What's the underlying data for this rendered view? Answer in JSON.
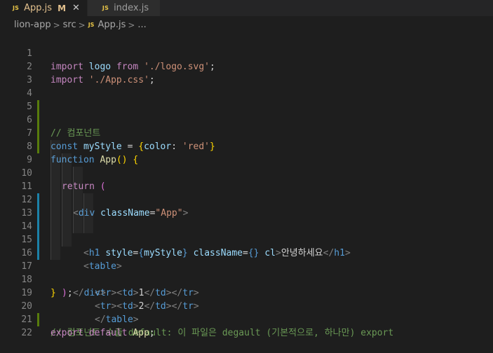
{
  "tabs": [
    {
      "label": "App.js",
      "badge": "JS",
      "modified": "M",
      "active": true
    },
    {
      "label": "index.js",
      "badge": "JS",
      "active": false
    }
  ],
  "breadcrumb": {
    "items": [
      "lion-app",
      "src",
      "App.js",
      "..."
    ],
    "file_badge": "JS"
  },
  "line_numbers": [
    "1",
    "2",
    "3",
    "4",
    "5",
    "6",
    "7",
    "8",
    "9",
    "10",
    "11",
    "12",
    "13",
    "14",
    "15",
    "16",
    "17",
    "18",
    "19",
    "20",
    "21",
    "22"
  ],
  "code": {
    "l1": {
      "kw": "import",
      "id": "logo",
      "from": "from",
      "str": "'./logo.svg'",
      "end": ";"
    },
    "l2": {
      "kw": "import",
      "str": "'./App.css'",
      "end": ";"
    },
    "l5": {
      "comment": "// 컴포넌트"
    },
    "l6": {
      "kw": "const",
      "id": "myStyle",
      "eq": "=",
      "ob": "{",
      "prop": "color",
      "colon": ":",
      "str": "'red'",
      "cb": "}"
    },
    "l8": {
      "kw": "function",
      "name": "App",
      "paren": "()",
      "ob": "{"
    },
    "l9": {
      "kw": "return",
      "op": "("
    },
    "l10": {
      "lt": "<",
      "tag": "div",
      "attr": "className",
      "eq": "=",
      "str": "\"App\"",
      "gt": ">"
    },
    "l11": {
      "lt": "<",
      "tag": "h1",
      "attr1": "style",
      "eq1": "=",
      "ob1": "{",
      "val1": "myStyle",
      "cb1": "}",
      "attr2": "className",
      "eq2": "=",
      "braces": "{}",
      "attr3": "cl",
      "gt": ">",
      "text": "안녕하세요",
      "close_lt": "</",
      "close_tag": "h1",
      "close_gt": ">"
    },
    "l12": {
      "lt": "<",
      "tag": "table",
      "gt": ">"
    },
    "l13": {
      "lt1": "<",
      "tag1": "tr",
      "gt1": "><",
      "tag2": "td",
      "gt2": ">",
      "text": "1",
      "cl1": "</",
      "tag3": "td",
      "cg1": "></",
      "tag4": "tr",
      "cg2": ">"
    },
    "l14": {
      "lt1": "<",
      "tag1": "tr",
      "gt1": "><",
      "tag2": "td",
      "gt2": ">",
      "text": "2",
      "cl1": "</",
      "tag3": "td",
      "cg1": "></",
      "tag4": "tr",
      "cg2": ">"
    },
    "l15": {
      "lt": "</",
      "tag": "table",
      "gt": ">"
    },
    "l16": {
      "lt": "</",
      "tag": "div",
      "gt": ">"
    },
    "l17": {
      "cp": ")",
      "end": ";"
    },
    "l18": {
      "cb": "}"
    },
    "l20": {
      "comment": "// 컴포넌트 수출 default: 이 파일은 degault (기본적으로, 하나만) export"
    },
    "l21": {
      "kw1": "export",
      "kw2": "default",
      "id": "App",
      "end": ";"
    }
  },
  "colors": {
    "background": "#1e1e1e",
    "keyword": "#c586c0",
    "string": "#ce9178",
    "variable": "#9cdcfe",
    "function": "#dcdcaa",
    "comment": "#6a9955",
    "tag": "#569cd6",
    "git_modified": "#1b81a8",
    "git_added": "#587c0c"
  }
}
